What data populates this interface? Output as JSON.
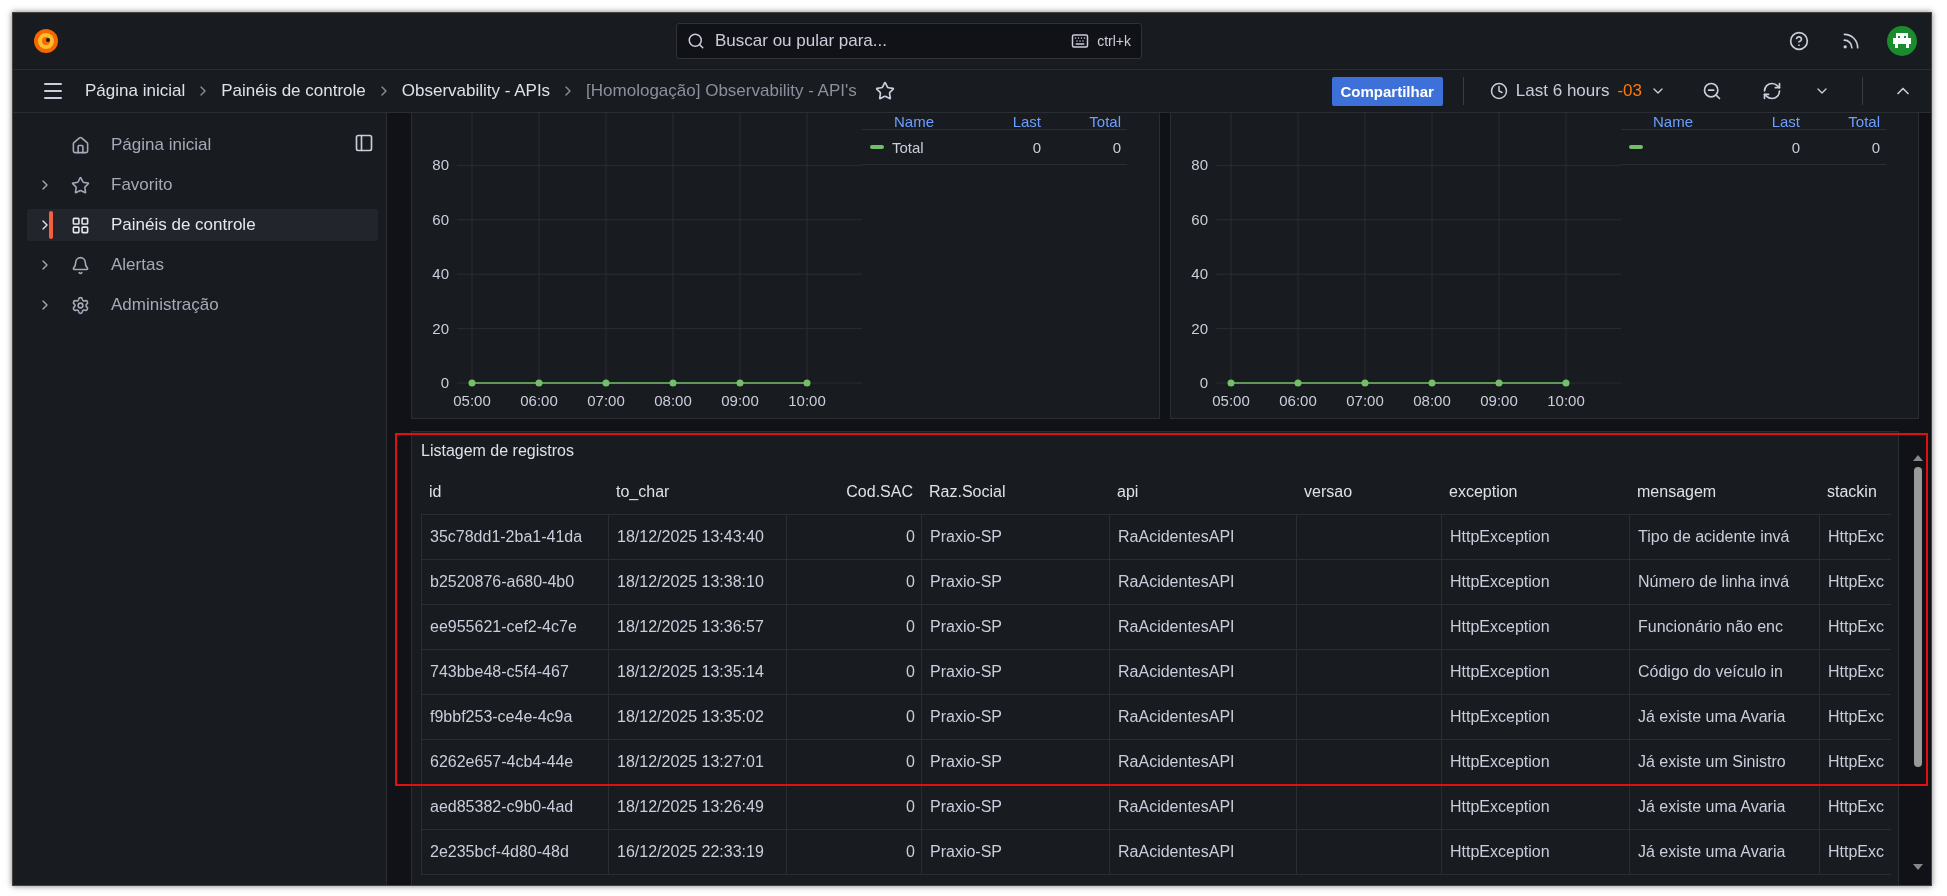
{
  "top_bar": {
    "search": {
      "placeholder": "Buscar ou pular para...",
      "shortcut": "ctrl+k"
    }
  },
  "breadcrumbs": [
    {
      "label": "Página inicial",
      "current": false
    },
    {
      "label": "Painéis de controle",
      "current": false
    },
    {
      "label": "Observability - APIs",
      "current": false
    },
    {
      "label": "[Homologação] Observability - API's",
      "current": true
    }
  ],
  "toolbar": {
    "share_button": "Compartilhar",
    "time_range": "Last 6 hours",
    "timezone": "-03"
  },
  "sidebar": {
    "items": [
      {
        "label": "Página inicial",
        "kind": "link",
        "selected": false
      },
      {
        "label": "Favorito",
        "kind": "section",
        "selected": false
      },
      {
        "label": "Painéis de controle",
        "kind": "section",
        "selected": true
      },
      {
        "label": "Alertas",
        "kind": "section",
        "selected": false
      },
      {
        "label": "Administração",
        "kind": "section",
        "selected": false
      }
    ]
  },
  "panels": [
    {
      "legend": {
        "columns": [
          "Name",
          "Last",
          "Total"
        ],
        "rows": [
          {
            "name": "Total",
            "color": "#73bf69",
            "last": "0",
            "total": "0"
          }
        ]
      },
      "chart_data": {
        "type": "line",
        "grid": true,
        "categories": [
          "05:00",
          "06:00",
          "07:00",
          "08:00",
          "09:00",
          "10:00"
        ],
        "series": [
          {
            "color": "#73bf69",
            "marker": true,
            "values": [
              0,
              0,
              0,
              0,
              0,
              0
            ]
          }
        ],
        "ylim": [
          0,
          100
        ],
        "yticks": [
          0,
          20,
          40,
          60,
          80
        ]
      }
    },
    {
      "legend": {
        "columns": [
          "Name",
          "Last",
          "Total"
        ],
        "rows": [
          {
            "color": "#73bf69",
            "last": "0",
            "total": "0"
          }
        ]
      },
      "chart_data": {
        "type": "line",
        "grid": true,
        "categories": [
          "05:00",
          "06:00",
          "07:00",
          "08:00",
          "09:00",
          "10:00"
        ],
        "series": [
          {
            "color": "#73bf69",
            "marker": true,
            "values": [
              0,
              0,
              0,
              0,
              0,
              0
            ]
          }
        ],
        "ylim": [
          0,
          100
        ],
        "yticks": [
          0,
          20,
          40,
          60,
          80
        ]
      }
    }
  ],
  "table": {
    "title": "Listagem de registros",
    "columns": [
      {
        "label": "id",
        "kind": "text"
      },
      {
        "label": "to_char",
        "kind": "text"
      },
      {
        "label": "Cod.SAC",
        "kind": "number"
      },
      {
        "label": "Raz.Social",
        "kind": "text"
      },
      {
        "label": "api",
        "kind": "text"
      },
      {
        "label": "versao",
        "kind": "text"
      },
      {
        "label": "exception",
        "kind": "text"
      },
      {
        "label": "mensagem",
        "kind": "text"
      },
      {
        "label": "stackin",
        "kind": "text"
      }
    ],
    "rows": [
      {
        "cells": [
          "35c78dd1-2ba1-41da",
          "18/12/2025 13:43:40",
          "0",
          "Praxio-SP",
          "RaAcidentesAPI",
          "",
          "HttpException",
          "Tipo de acidente invá",
          "HttpExc"
        ]
      },
      {
        "cells": [
          "b2520876-a680-4b0",
          "18/12/2025 13:38:10",
          "0",
          "Praxio-SP",
          "RaAcidentesAPI",
          "",
          "HttpException",
          "Número de linha invá",
          "HttpExc"
        ]
      },
      {
        "cells": [
          "ee955621-cef2-4c7e",
          "18/12/2025 13:36:57",
          "0",
          "Praxio-SP",
          "RaAcidentesAPI",
          "",
          "HttpException",
          "Funcionário não enc",
          "HttpExc"
        ]
      },
      {
        "cells": [
          "743bbe48-c5f4-467",
          "18/12/2025 13:35:14",
          "0",
          "Praxio-SP",
          "RaAcidentesAPI",
          "",
          "HttpException",
          "Código do veículo in",
          "HttpExc"
        ]
      },
      {
        "cells": [
          "f9bbf253-ce4e-4c9a",
          "18/12/2025 13:35:02",
          "0",
          "Praxio-SP",
          "RaAcidentesAPI",
          "",
          "HttpException",
          "Já existe uma Avaria",
          "HttpExc"
        ]
      },
      {
        "cells": [
          "6262e657-4cb4-44e",
          "18/12/2025 13:27:01",
          "0",
          "Praxio-SP",
          "RaAcidentesAPI",
          "",
          "HttpException",
          "Já existe um Sinistro",
          "HttpExc"
        ]
      },
      {
        "cells": [
          "aed85382-c9b0-4ad",
          "18/12/2025 13:26:49",
          "0",
          "Praxio-SP",
          "RaAcidentesAPI",
          "",
          "HttpException",
          "Já existe uma Avaria",
          "HttpExc"
        ]
      },
      {
        "cells": [
          "2e235bcf-4d80-48d",
          "16/12/2025 22:33:19",
          "0",
          "Praxio-SP",
          "RaAcidentesAPI",
          "",
          "HttpException",
          "Já existe uma Avaria",
          "HttpExc"
        ]
      }
    ]
  }
}
